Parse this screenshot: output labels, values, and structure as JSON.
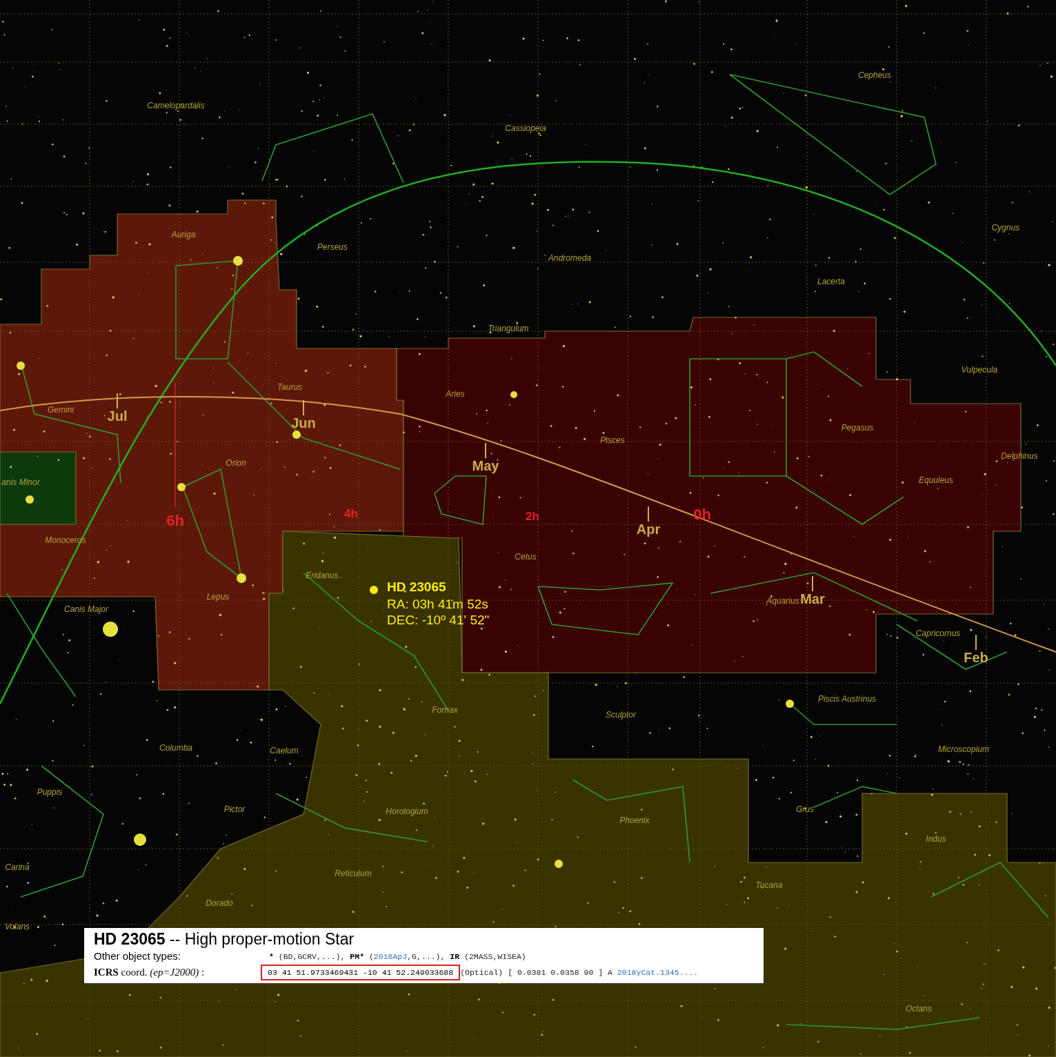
{
  "star_chart": {
    "constellations": [
      "Camelopardalis",
      "Cassiopeia",
      "Cepheus",
      "Auriga",
      "Perseus",
      "Andromeda",
      "Cygnus",
      "Lacerta",
      "Triangulum",
      "Gemini",
      "Taurus",
      "Aries",
      "Vulpecula",
      "Pegasus",
      "Pisces",
      "Orion",
      "Delphinus",
      "Equuleus",
      "anis Minor",
      "Monoceros",
      "Cetus",
      "Eridanus",
      "Aquarius",
      "Lepus",
      "Canis Major",
      "Capricornus",
      "Fornax",
      "Sculptor",
      "Piscis Austrinus",
      "Columba",
      "Caelum",
      "Microscopium",
      "Puppis",
      "Pictor",
      "Horologium",
      "Phoenix",
      "Grus",
      "Carina",
      "Indus",
      "Reticulum",
      "Tucana",
      "Dorado",
      "Volans",
      "Octans"
    ],
    "months": [
      "Jul",
      "Jun",
      "May",
      "Apr",
      "Mar",
      "Feb"
    ],
    "hour_marks": [
      "6h",
      "4h",
      "2h",
      "0h"
    ],
    "target": {
      "name": "HD 23065",
      "ra": "RA: 03h 41m 52s",
      "dec": "DEC: -10º 41' 52\""
    }
  },
  "info_box": {
    "name": "HD 23065",
    "type": " -- High proper-motion Star",
    "rows": [
      {
        "label": "Other object types:",
        "parts": [
          {
            "kind": "code",
            "text": "* "
          },
          {
            "kind": "plain",
            "text": "(BD,GCRV,...), "
          },
          {
            "kind": "code",
            "text": "PM* "
          },
          {
            "kind": "plain",
            "text": "("
          },
          {
            "kind": "link",
            "text": "2016ApJ"
          },
          {
            "kind": "plain",
            "text": ",G,...), "
          },
          {
            "kind": "code",
            "text": "IR "
          },
          {
            "kind": "plain",
            "text": "(2MASS,WISEA)"
          }
        ]
      },
      {
        "label": "**ICRS** coord. *(ep=J2000)* :",
        "parts": [
          {
            "kind": "boxed",
            "text": "03 41 51.9733469431 -10 41 52.249033688"
          },
          {
            "kind": "plain",
            "text": "(Optical) [ 0.0381 0.0358 90 ] A "
          },
          {
            "kind": "link",
            "text": "2018yCat.1345...."
          }
        ]
      }
    ]
  }
}
